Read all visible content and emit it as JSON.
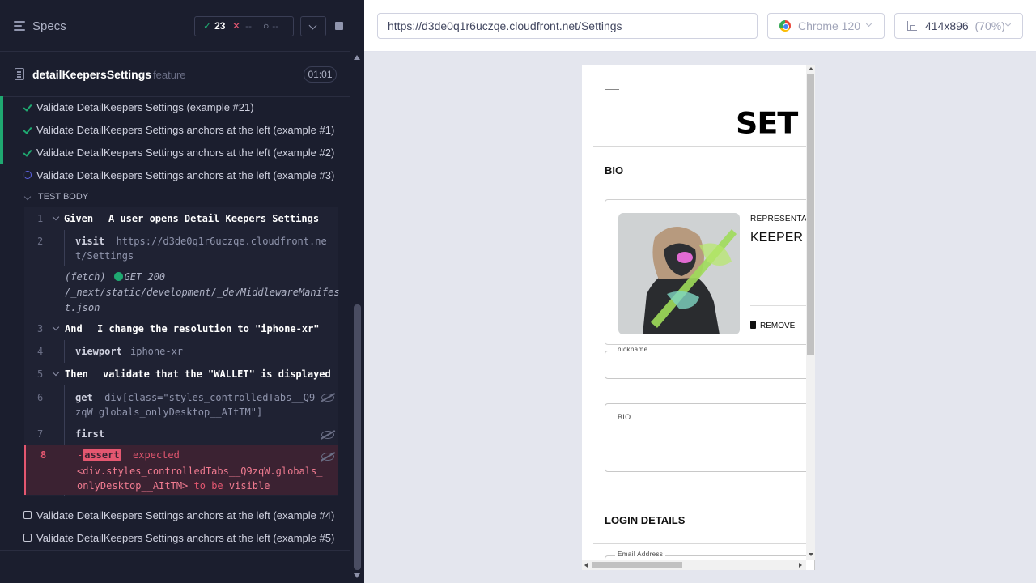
{
  "runner": {
    "specs_title": "Specs",
    "stats": {
      "passed": "23",
      "failed": "--",
      "pending": "--"
    },
    "spec": {
      "name": "detailKeepersSettings",
      "ext": "feature",
      "duration": "01:01"
    },
    "tests": [
      {
        "label": "Validate DetailKeepers Settings (example #21)",
        "state": "passed"
      },
      {
        "label": "Validate DetailKeepers Settings anchors at the left (example #1)",
        "state": "passed"
      },
      {
        "label": "Validate DetailKeepers Settings anchors at the left (example #2)",
        "state": "passed"
      },
      {
        "label": "Validate DetailKeepers Settings anchors at the left (example #3)",
        "state": "running"
      },
      {
        "label": "Validate DetailKeepers Settings anchors at the left (example #4)",
        "state": "queued"
      },
      {
        "label": "Validate DetailKeepers Settings anchors at the left (example #5)",
        "state": "queued"
      }
    ],
    "test_body_label": "TEST BODY",
    "commands": {
      "c1": {
        "num": "1",
        "keyword": "Given",
        "text": "A user opens Detail Keepers Settings"
      },
      "c2": {
        "num": "2",
        "name": "visit",
        "value": "https://d3de0q1r6uczqe.cloudfront.net/Settings"
      },
      "fetch": {
        "prefix": "(fetch)",
        "status": "GET 200",
        "path": "/_next/static/development/_devMiddlewareManifest.json"
      },
      "c3": {
        "num": "3",
        "keyword": "And",
        "text": "I change the resolution to \"iphone-xr\""
      },
      "c4": {
        "num": "4",
        "name": "viewport",
        "value": "iphone-xr"
      },
      "c5": {
        "num": "5",
        "keyword": "Then",
        "text": "validate that the \"WALLET\" is displayed"
      },
      "c6": {
        "num": "6",
        "name": "get",
        "value": "div[class=\"styles_controlledTabs__Q9zqW globals_onlyDesktop__AItTM\"]"
      },
      "c7": {
        "num": "7",
        "name": "first"
      },
      "c8": {
        "num": "8",
        "prefix": "-",
        "name": "assert",
        "expected": "expected",
        "subject": "<div.styles_controlledTabs__Q9zqW.globals_onlyDesktop__AItTM>",
        "to_be": "to be",
        "state": "visible"
      }
    }
  },
  "browser": {
    "url": "https://d3de0q1r6uczqe.cloudfront.net/Settings",
    "name": "Chrome 120",
    "viewport": "414x896",
    "zoom": "(70%)"
  },
  "app": {
    "page_title": "SET",
    "bio_section": "BIO",
    "representative_label": "REPRESENTATIVE",
    "role": "KEEPER",
    "remove_label": "REMOVE",
    "nickname_label": "nickname",
    "bio_field_label": "BIO",
    "login_section": "LOGIN DETAILS",
    "email_label": "Email Address"
  }
}
